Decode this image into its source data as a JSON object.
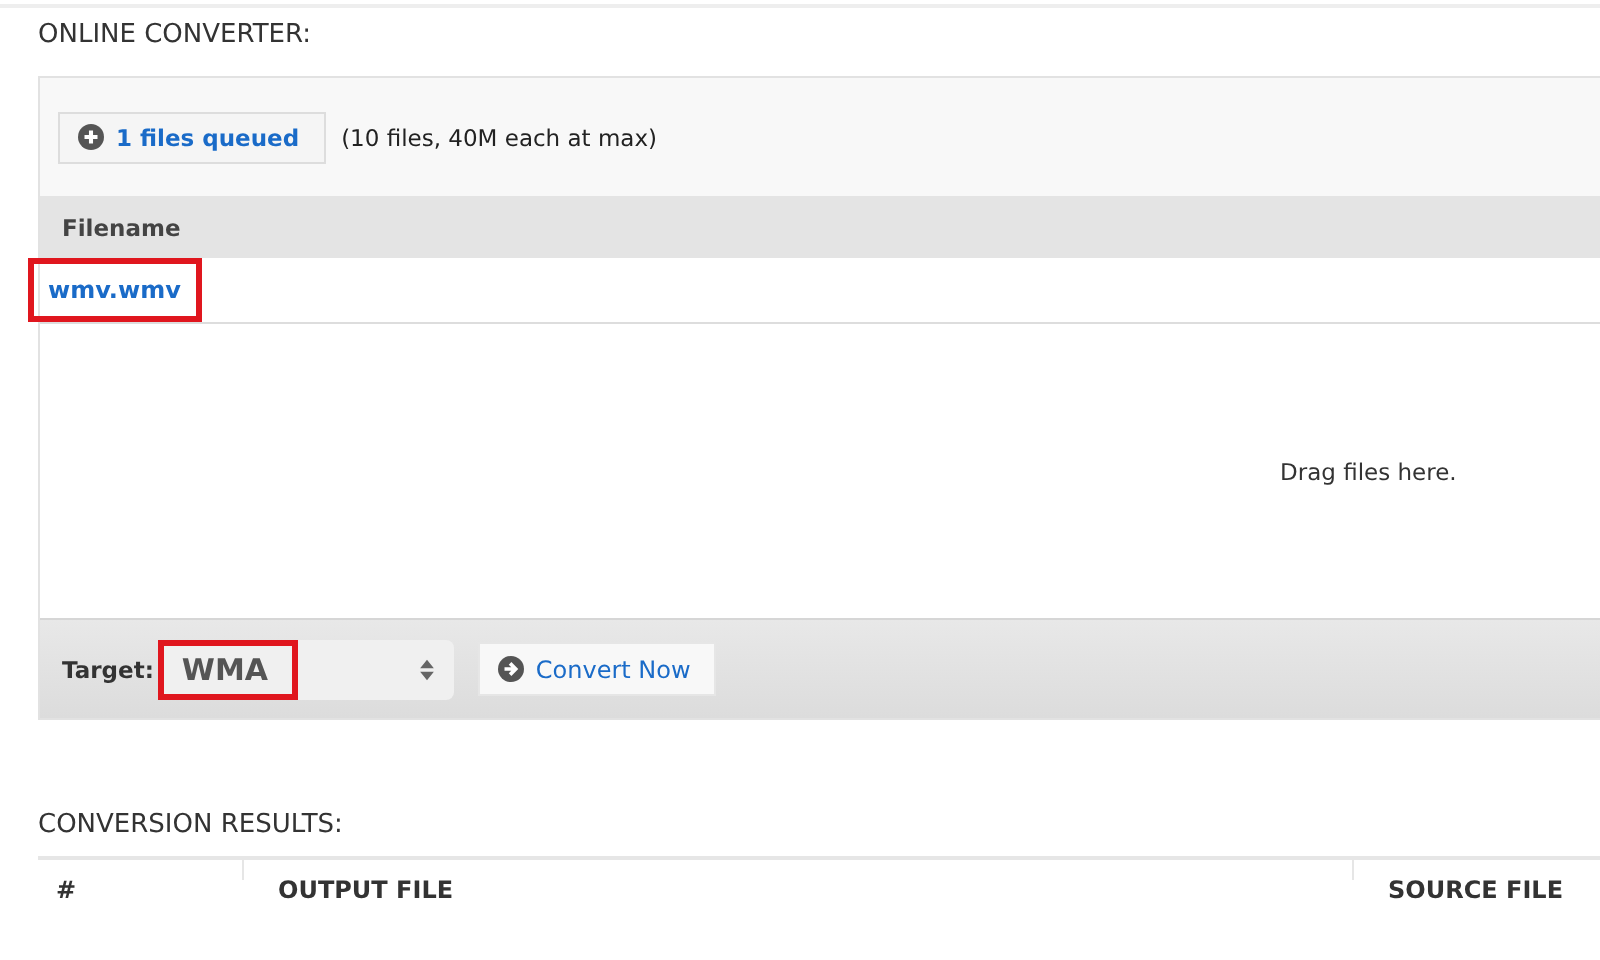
{
  "converter": {
    "title": "ONLINE CONVERTER:",
    "queue_button": {
      "label": "1 files queued"
    },
    "limit_note": "(10 files, 40M each at max)",
    "file_table": {
      "columns": [
        "Filename"
      ],
      "rows": [
        {
          "filename": "wmv.wmv",
          "highlighted": true
        }
      ]
    },
    "drop_hint": "Drag files here.",
    "target": {
      "label": "Target:",
      "value": "WMA",
      "highlighted": true
    },
    "convert_button": {
      "label": "Convert Now"
    }
  },
  "results": {
    "title": "CONVERSION RESULTS:",
    "columns": [
      "#",
      "OUTPUT FILE",
      "SOURCE FILE"
    ]
  }
}
